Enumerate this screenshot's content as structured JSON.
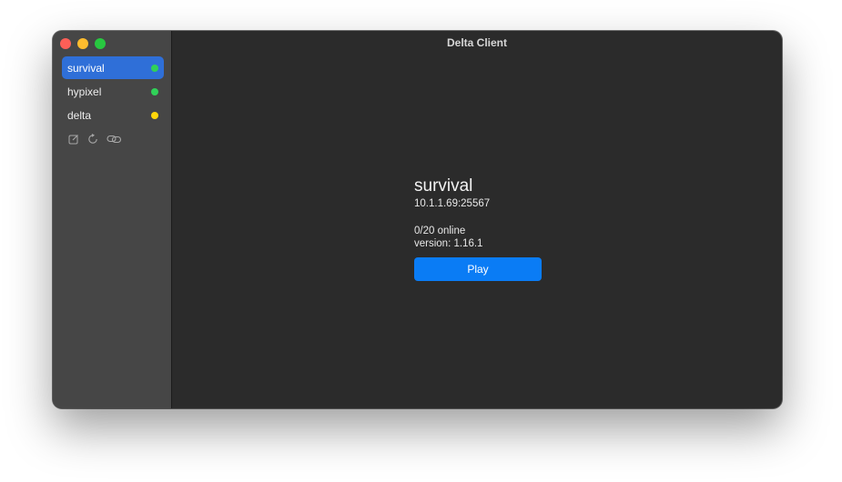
{
  "window": {
    "title": "Delta Client"
  },
  "sidebar": {
    "servers": [
      {
        "name": "survival",
        "status_color": "#30d158",
        "selected": true
      },
      {
        "name": "hypixel",
        "status_color": "#30d158",
        "selected": false
      },
      {
        "name": "delta",
        "status_color": "#ffd60a",
        "selected": false
      }
    ],
    "tools": [
      {
        "icon": "edit-icon"
      },
      {
        "icon": "refresh-icon"
      },
      {
        "icon": "link-icon"
      }
    ]
  },
  "detail": {
    "title": "survival",
    "address": "10.1.1.69:25567",
    "online": "0/20 online",
    "version": "version: 1.16.1",
    "play_label": "Play"
  },
  "colors": {
    "accent": "#0a7cf5",
    "selection": "#2f6fd8",
    "online": "#30d158",
    "warning": "#ffd60a"
  }
}
